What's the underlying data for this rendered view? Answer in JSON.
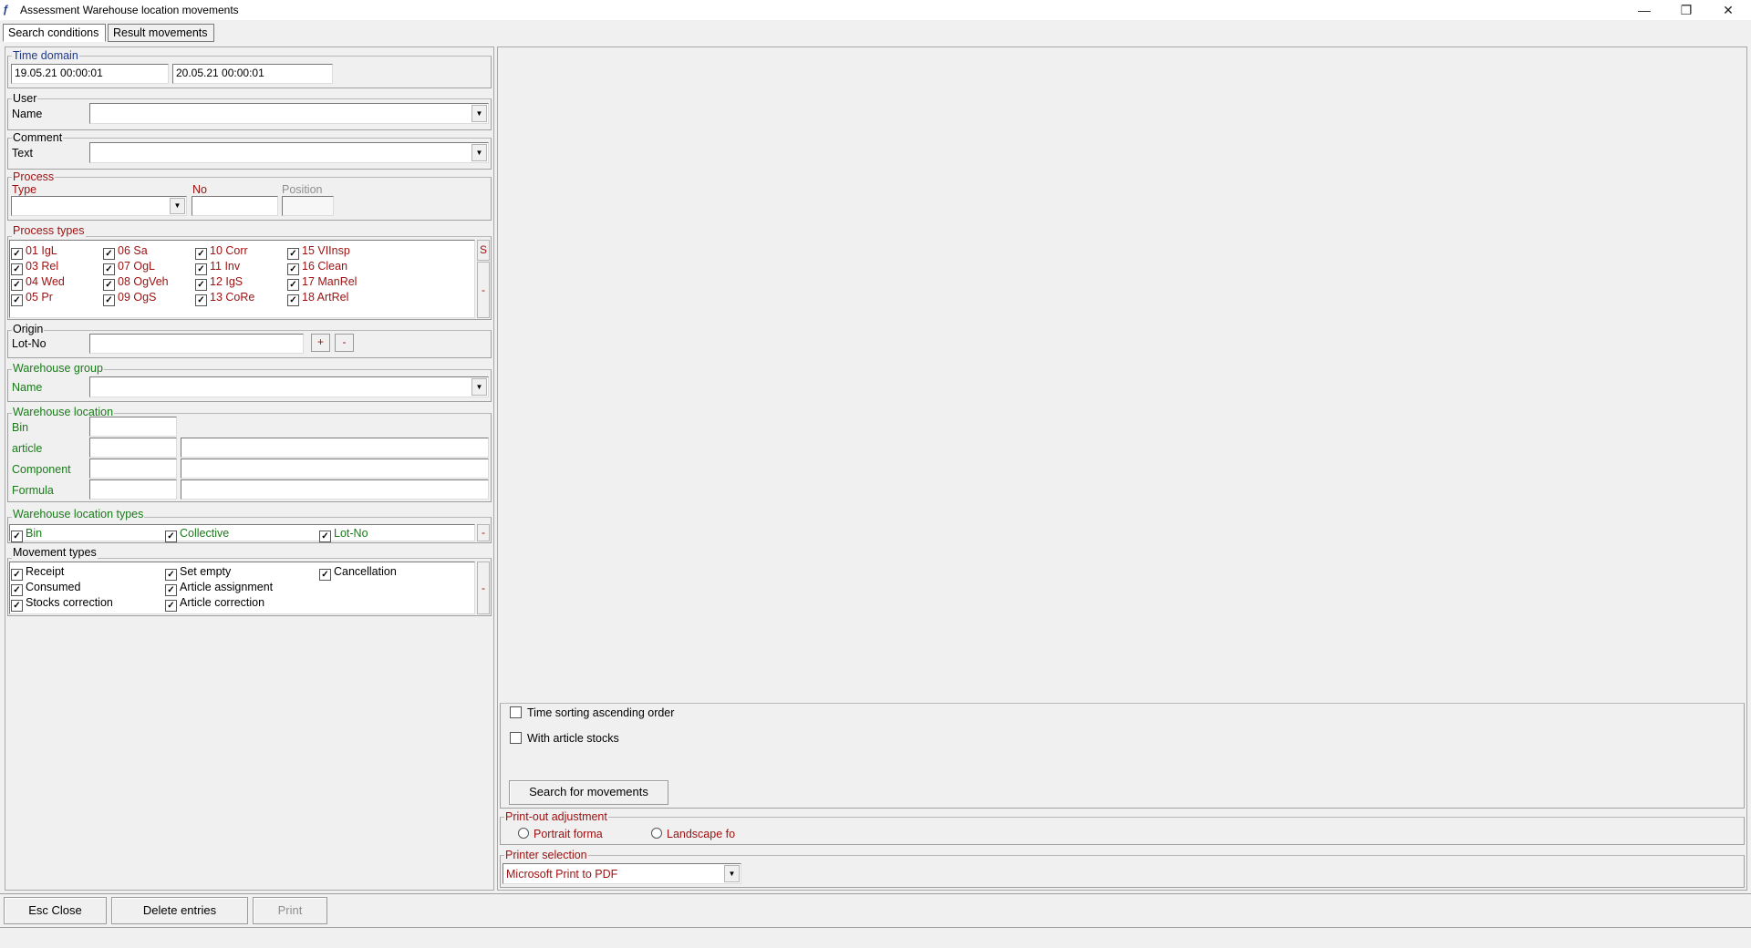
{
  "window": {
    "title": "Assessment Warehouse location movements",
    "minimize": "—",
    "restore": "❐",
    "close": "✕"
  },
  "tabs": [
    {
      "label": "Search conditions"
    },
    {
      "label": "Result movements"
    }
  ],
  "time_domain": {
    "title": "Time domain",
    "from": "19.05.21 00:00:01",
    "to": "20.05.21 00:00:01"
  },
  "user": {
    "title": "User",
    "label": "Name",
    "value": ""
  },
  "comment": {
    "title": "Comment",
    "label": "Text",
    "value": ""
  },
  "process": {
    "title": "Process",
    "type_label": "Type",
    "no_label": "No",
    "position_label": "Position",
    "type_value": "",
    "no_value": "",
    "position_value": ""
  },
  "process_types": {
    "title": "Process types",
    "items": [
      "01 IgL",
      "03 Rel",
      "04 Wed",
      "05 Pr",
      "06 Sa",
      "07 OgL",
      "08 OgVeh",
      "09 OgS",
      "10 Corr",
      "11 Inv",
      "12 IgS",
      "13 CoRe",
      "15 VIInsp",
      "16 Clean",
      "17 ManRel",
      "18 ArtRel"
    ],
    "side_top": "S",
    "side_bottom": "-"
  },
  "origin": {
    "title": "Origin",
    "label": "Lot-No",
    "value": "",
    "plus": "+",
    "minus": "-"
  },
  "warehouse_group": {
    "title": "Warehouse group",
    "label": "Name",
    "value": ""
  },
  "warehouse_location": {
    "title": "Warehouse location",
    "bin": "Bin",
    "article": "article",
    "component": "Component",
    "formula": "Formula"
  },
  "location_types": {
    "title": "Warehouse location types",
    "items": [
      "Bin",
      "Collective",
      "Lot-No"
    ],
    "side": "-"
  },
  "movement_types": {
    "title": "Movement types",
    "items": [
      "Receipt",
      "Consumed",
      "Stocks correction",
      "Set empty",
      "Article assignment",
      "Article correction",
      "Cancellation"
    ],
    "side": "-"
  },
  "options": {
    "time_sorting": "Time sorting ascending order",
    "article_stocks": "With article stocks",
    "search_button": "Search for movements"
  },
  "printout": {
    "title": "Print-out adjustment",
    "portrait": "Portrait forma",
    "landscape": "Landscape fo"
  },
  "printer": {
    "title": "Printer selection",
    "value": "Microsoft Print to PDF"
  },
  "bottom": {
    "esc_close": "Esc Close",
    "delete_entries": "Delete entries",
    "print": "Print"
  }
}
